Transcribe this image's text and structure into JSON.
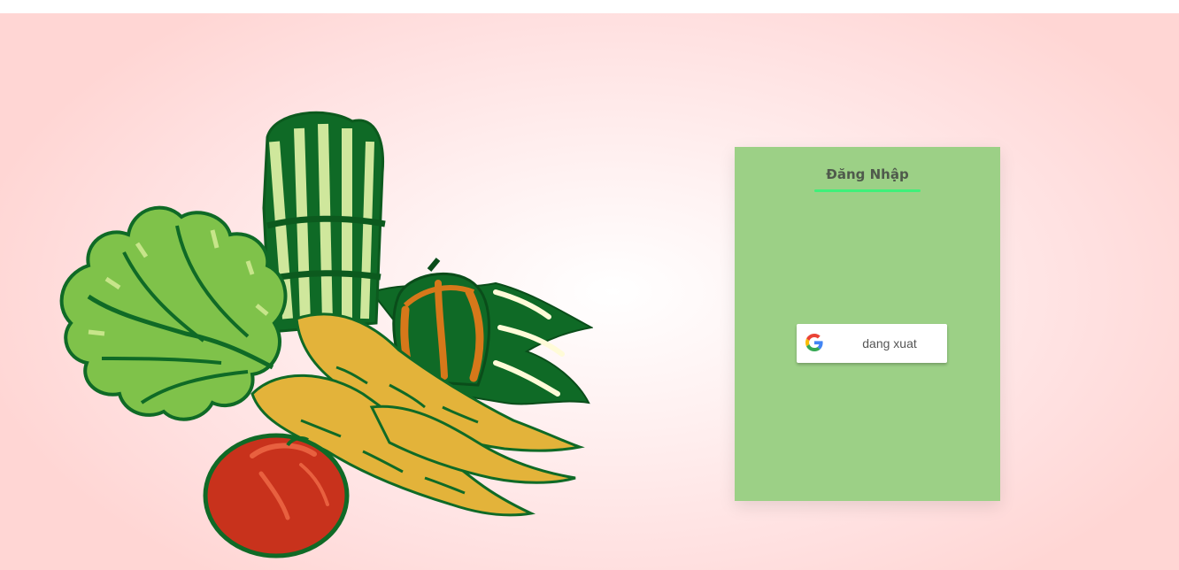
{
  "login": {
    "title": "Đăng Nhập",
    "google_button_label": "dang xuat"
  },
  "icons": {
    "google": "google-g-icon"
  },
  "colors": {
    "card_background": "#9cd086",
    "title_underline": "#3ff07a",
    "title_text": "#4f5a4c",
    "page_background": "#ffe0e0"
  }
}
